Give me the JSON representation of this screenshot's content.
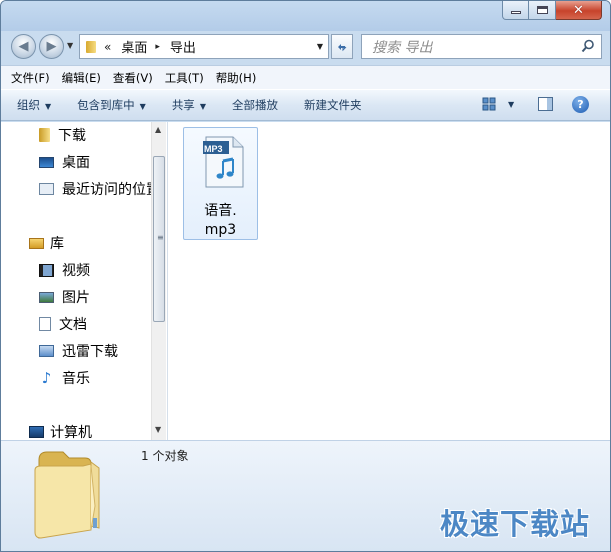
{
  "window": {
    "controls": {
      "minimize_icon": "minimize-icon",
      "maximize_icon": "maximize-icon",
      "close_glyph": "✕"
    }
  },
  "navigation": {
    "back_glyph": "◀",
    "forward_glyph": "▶",
    "address": {
      "overflow": "«",
      "crumbs": [
        "桌面",
        "导出"
      ],
      "separator": "▸"
    },
    "search_placeholder": "搜索 导出"
  },
  "menubar": {
    "items": [
      "文件(F)",
      "编辑(E)",
      "查看(V)",
      "工具(T)",
      "帮助(H)"
    ]
  },
  "toolbar": {
    "items": [
      {
        "label": "组织",
        "dropdown": true
      },
      {
        "label": "包含到库中",
        "dropdown": true
      },
      {
        "label": "共享",
        "dropdown": true
      },
      {
        "label": "全部播放",
        "dropdown": false
      },
      {
        "label": "新建文件夹",
        "dropdown": false
      }
    ],
    "help_label": "?"
  },
  "nav_pane": {
    "favorites": [
      {
        "label": "下载",
        "icon": "folder-icon"
      },
      {
        "label": "桌面",
        "icon": "desktop-icon"
      },
      {
        "label": "最近访问的位置",
        "icon": "recent-places-icon"
      }
    ],
    "libraries_label": "库",
    "libraries": [
      {
        "label": "视频",
        "icon": "video-icon"
      },
      {
        "label": "图片",
        "icon": "picture-icon"
      },
      {
        "label": "文档",
        "icon": "document-icon"
      },
      {
        "label": "迅雷下载",
        "icon": "thunder-download-icon"
      },
      {
        "label": "音乐",
        "icon": "music-icon"
      }
    ],
    "computer_label": "计算机"
  },
  "content": {
    "files": [
      {
        "name_line1": "语音.",
        "name_line2": "mp3",
        "badge": "MP3",
        "type": "mp3-file-icon"
      }
    ]
  },
  "details": {
    "count_text": "1 个对象"
  },
  "watermark": "极速下载站",
  "colors": {
    "accent": "#4c87c5",
    "toolbar_text": "#1e3c5f",
    "close_red": "#c7432b"
  }
}
